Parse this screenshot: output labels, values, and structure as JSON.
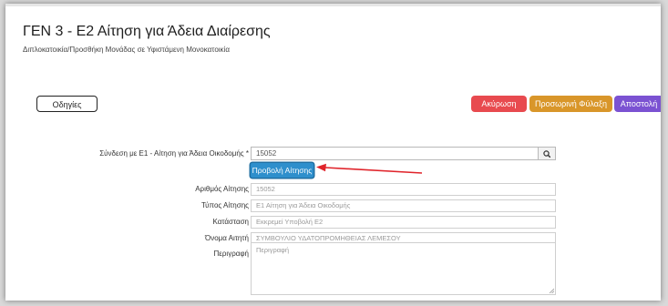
{
  "page": {
    "title": "ΓΕΝ 3 - Ε2 Αίτηση για Άδεια Διαίρεσης",
    "subtitle": "Διπλοκατοικία/Προσθήκη Μονάδας σε Υφιστάμενη Μονοκατοικία"
  },
  "toolbar": {
    "help_label": "Οδηγίες",
    "cancel_label": "Ακύρωση",
    "draft_label": "Προσωρινή Φύλαξη",
    "send_label": "Αποστολή"
  },
  "form": {
    "link_label": "Σύνδεση με Ε1 - Αίτηση για Άδεια Οικοδομής *",
    "link_value": "15052",
    "search_icon": "search-icon",
    "view_button_label": "Προβολή Αίτησης",
    "fields": [
      {
        "label": "Αριθμός Αίτησης",
        "value": "15052"
      },
      {
        "label": "Τύπος Αίτησης",
        "value": "Ε1 Αίτηση για Άδεια Οικοδομής"
      },
      {
        "label": "Κατάσταση",
        "value": "Εκκρεμεί Υποβολή Ε2"
      },
      {
        "label": "Όνομα Αιτητή",
        "value": "ΣΥΜΒΟΥΛΙΟ ΥΔΑΤΟΠΡΟΜΗΘΕΙΑΣ ΛΕΜΕΣΟΥ"
      }
    ],
    "description_label": "Περιγραφή",
    "description_placeholder": "Περιγραφή"
  },
  "colors": {
    "cancel": "#e84a4f",
    "draft": "#d9962a",
    "send": "#7b52d2",
    "primary": "#2e8fcc",
    "annotation_arrow": "#e0242b"
  }
}
